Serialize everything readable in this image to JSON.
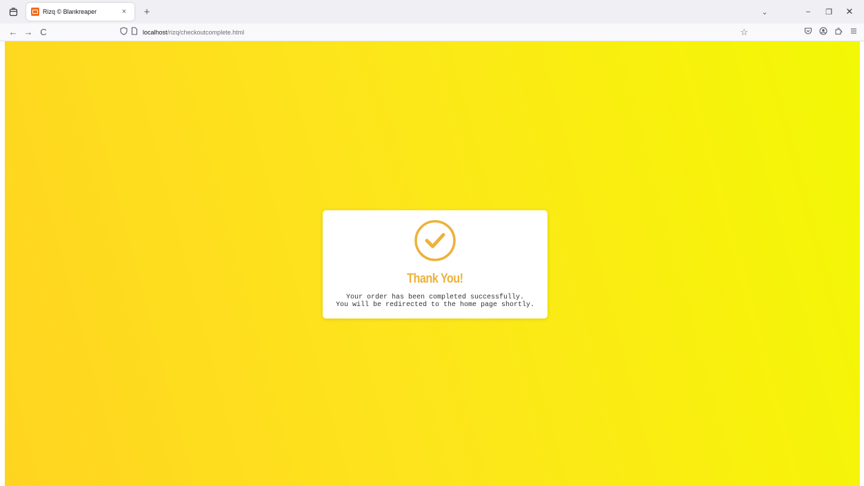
{
  "browser": {
    "tab_title": "Rizq © Blankreaper",
    "tab_close": "×",
    "new_tab": "+",
    "tab_overflow": "⌄",
    "window_minimize": "–",
    "window_restore": "❐",
    "window_close": "✕",
    "nav_back": "←",
    "nav_forward": "→",
    "nav_reload": "C",
    "url_host": "localhost",
    "url_path": "/rizq/checkoutcomplete.html",
    "bookmark_star": "☆",
    "icons": [
      "tab-list-icon",
      "favicon-icon",
      "shield-icon",
      "page-icon",
      "star-icon",
      "pocket-icon",
      "account-icon",
      "extensions-icon",
      "menu-icon"
    ]
  },
  "card": {
    "title": "Thank You!",
    "message_line1": "Your order has been completed successfully.",
    "message_line2": "You will be redirected to the home page shortly.",
    "icon": "check-circle-icon",
    "accent_color": "#ecb23c"
  },
  "colors": {
    "background_start": "#ffd420",
    "background_end": "#f2f805"
  }
}
